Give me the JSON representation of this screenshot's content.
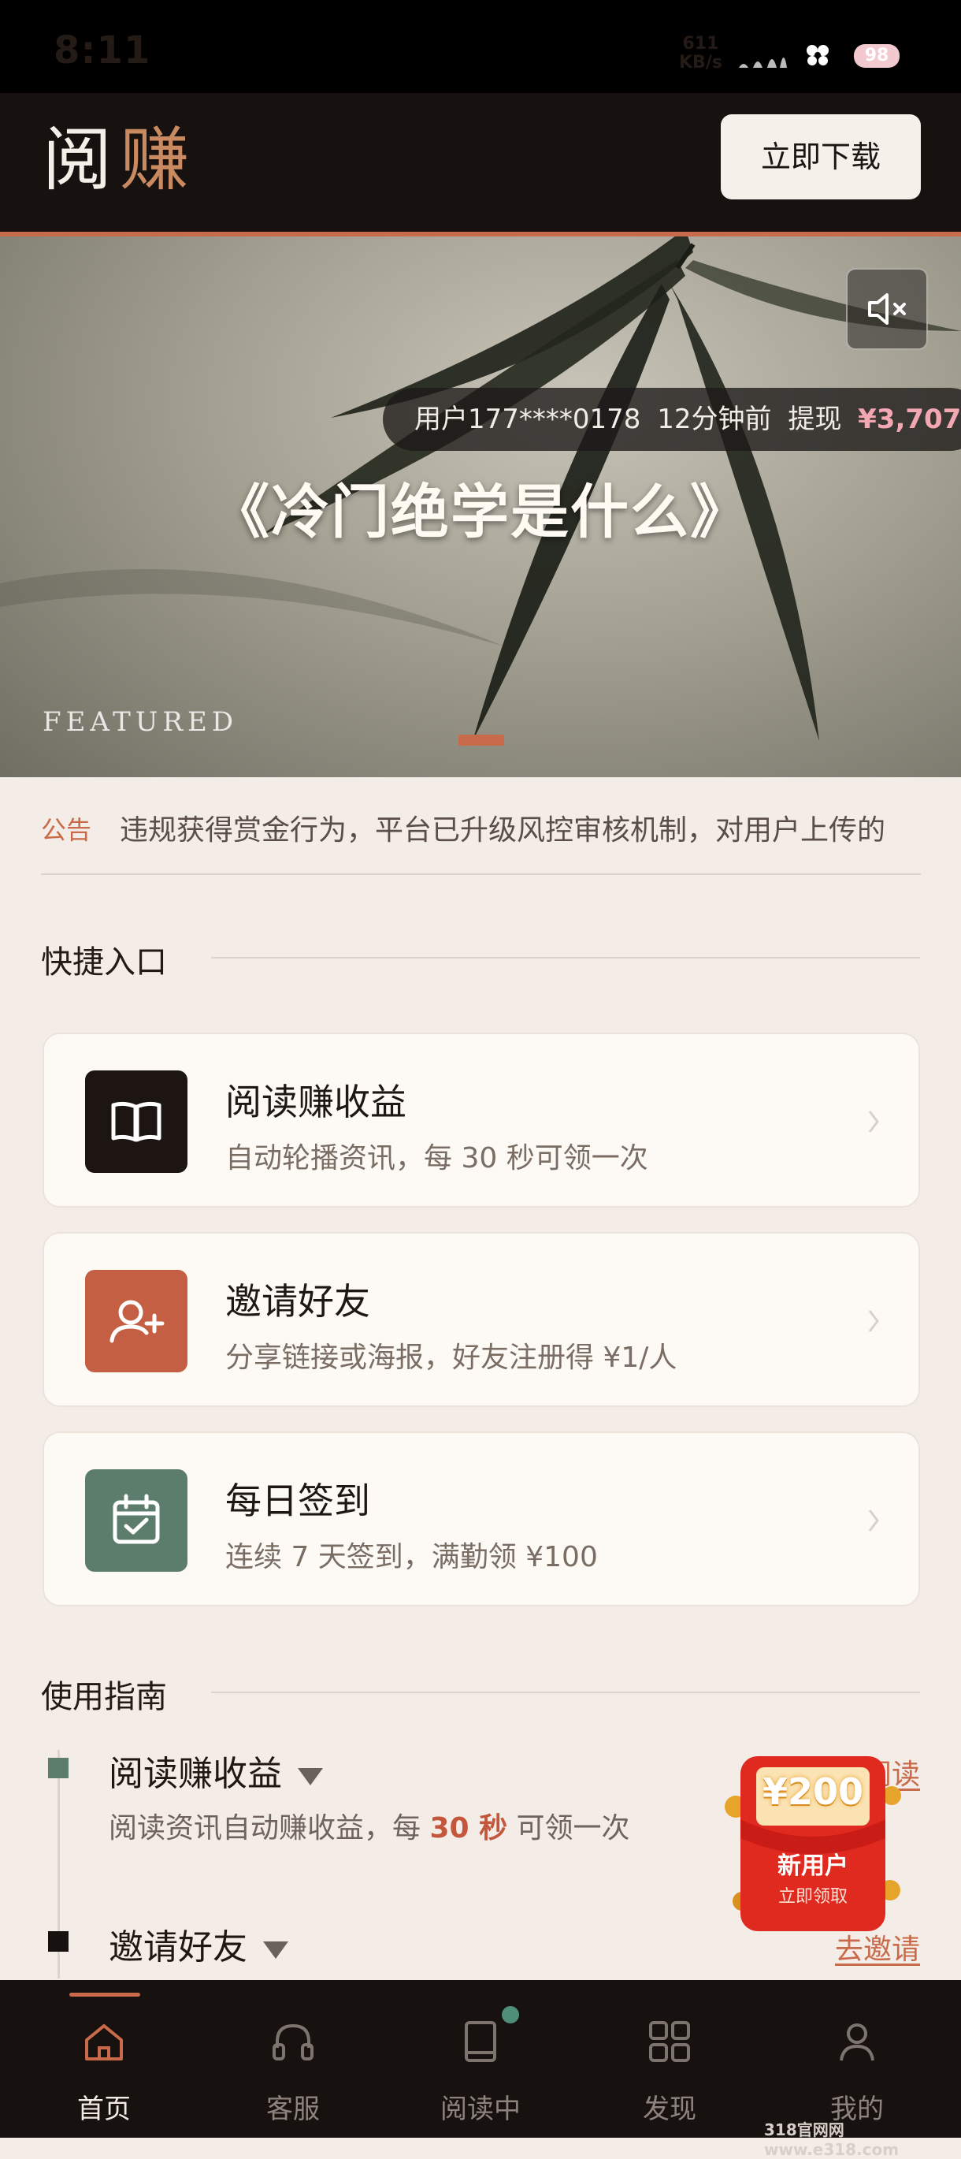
{
  "status_bar": {
    "time": "8:11",
    "net_speed_value": "611",
    "net_speed_unit": "KB/s",
    "battery": "98"
  },
  "header": {
    "logo_part1": "阅",
    "logo_part2": "赚",
    "download_button": "立即下载"
  },
  "banner": {
    "ticker_user": "用户177****0178",
    "ticker_time": "12分钟前",
    "ticker_action": "提现",
    "ticker_amount": "¥3,707",
    "title": "《冷门绝学是什么》",
    "featured": "FEATURED",
    "mute_icon": "speaker-mute-icon"
  },
  "notice": {
    "label": "公告",
    "text": "违规获得赏金行为，平台已升级风控审核机制，对用户上传的"
  },
  "quick_entry": {
    "title": "快捷入口",
    "cards": [
      {
        "title": "阅读赚收益",
        "desc": "自动轮播资讯，每 30 秒可领一次",
        "icon": "book-icon",
        "color": "#1c1511"
      },
      {
        "title": "邀请好友",
        "desc": "分享链接或海报，好友注册得 ¥1/人",
        "icon": "add-user-icon",
        "color": "#c55f43"
      },
      {
        "title": "每日签到",
        "desc": "连续 7 天签到，满勤领 ¥100",
        "icon": "calendar-check-icon",
        "color": "#5d7d6c"
      }
    ]
  },
  "guide": {
    "title": "使用指南",
    "items": [
      {
        "title": "阅读赚收益",
        "desc_pre": "阅读资讯自动赚收益，每 ",
        "desc_highlight": "30 秒",
        "desc_post": " 可领一次",
        "link": "去阅读"
      },
      {
        "title": "邀请好友",
        "link": "去邀请"
      }
    ]
  },
  "promo": {
    "amount": "¥200",
    "line1": "新用户",
    "line2": "立即领取"
  },
  "bottom_nav": {
    "items": [
      {
        "label": "首页",
        "icon": "home-icon"
      },
      {
        "label": "客服",
        "icon": "headset-icon"
      },
      {
        "label": "阅读中",
        "icon": "book-reading-icon"
      },
      {
        "label": "发现",
        "icon": "grid-icon"
      },
      {
        "label": "我的",
        "icon": "user-icon"
      }
    ]
  },
  "watermark": "318官网网 www.e318.com",
  "colors": {
    "accent": "#c96a4a",
    "dark": "#17120f",
    "background": "#f3ece7",
    "highlight_amount": "#f3a7b3"
  }
}
